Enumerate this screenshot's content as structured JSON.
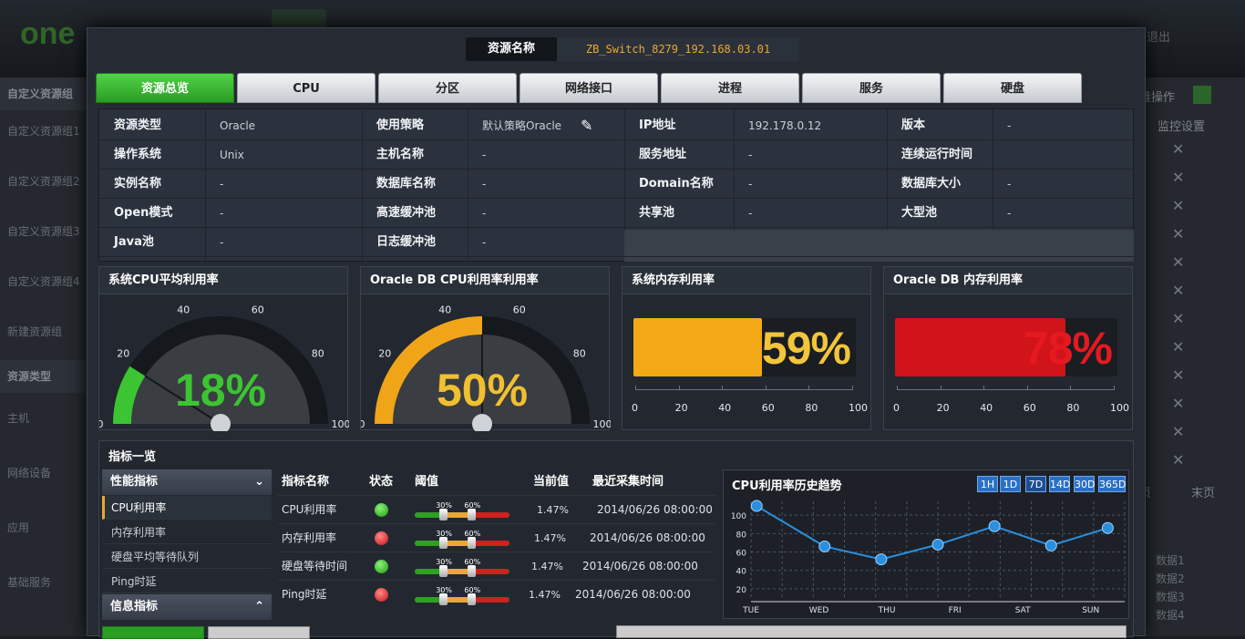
{
  "background": {
    "logo": "one",
    "logout": "退出",
    "left_items": [
      "自定义资源组",
      "自定义资源组1",
      "自定义资源组2",
      "自定义资源组3",
      "自定义资源组4",
      "新建资源组",
      "资源类型",
      "主机",
      "网络设备",
      "应用",
      "基础服务"
    ],
    "right_header_a": "量操作",
    "right_header_b": "监控设置",
    "pager_a": "页",
    "pager_b": "末页",
    "legend": [
      "数据1",
      "数据2",
      "数据3",
      "数据4"
    ]
  },
  "header": {
    "name_label": "资源名称",
    "name_value": "ZB_Switch_8279_192.168.03.01"
  },
  "tabs": [
    "资源总览",
    "CPU",
    "分区",
    "网络接口",
    "进程",
    "服务",
    "硬盘"
  ],
  "info": {
    "rows": [
      [
        [
          "资源类型",
          "Oracle"
        ],
        [
          "使用策略",
          "默认策略Oracle"
        ],
        [
          "IP地址",
          "192.178.0.12"
        ],
        [
          "版本",
          "-"
        ]
      ],
      [
        [
          "操作系统",
          "Unix"
        ],
        [
          "主机名称",
          "-"
        ],
        [
          "服务地址",
          "-"
        ],
        [
          "连续运行时间",
          ""
        ]
      ],
      [
        [
          "实例名称",
          "-"
        ],
        [
          "数据库名称",
          "-"
        ],
        [
          "Domain名称",
          "-"
        ],
        [
          "数据库大小",
          "-"
        ]
      ],
      [
        [
          "Open模式",
          "-"
        ],
        [
          "高速缓冲池",
          "-"
        ],
        [
          "共享池",
          "-"
        ],
        [
          "大型池",
          "-"
        ]
      ],
      [
        [
          "Java池",
          "-"
        ],
        [
          "日志缓冲池",
          "-"
        ]
      ]
    ]
  },
  "gauges": [
    {
      "title": "系统CPU平均利用率",
      "value": 18,
      "label": "18%",
      "color": "#3cc432",
      "text_color": "#3cc432"
    },
    {
      "title": "Oracle DB CPU利用率利用率",
      "value": 50,
      "label": "50%",
      "color": "#f0a418",
      "text_color": "#f0c030"
    }
  ],
  "gauge_ticks": [
    "0",
    "20",
    "40",
    "60",
    "80",
    "100"
  ],
  "bars": [
    {
      "title": "系统内存利用率",
      "value": 59,
      "label": "59%",
      "color": "#f2a915",
      "text_color": "#f2c53a"
    },
    {
      "title": "Oracle DB 内存利用率",
      "value": 78,
      "label": "78%",
      "color": "#d0141a",
      "text_color": "#e5191f"
    }
  ],
  "bar_ticks": [
    "0",
    "20",
    "40",
    "60",
    "80",
    "100"
  ],
  "metrics": {
    "title": "指标一览",
    "perf_head": "性能指标",
    "perf_items": [
      "CPU利用率",
      "内存利用率",
      "硬盘平均等待队列",
      "Ping时延"
    ],
    "info_head": "信息指标",
    "columns": [
      "指标名称",
      "状态",
      "阈值",
      "当前值",
      "最近采集时间"
    ],
    "rows": [
      {
        "name": "CPU利用率",
        "status": "green",
        "low": "30%",
        "high": "60%",
        "value": "1.47%",
        "time": "2014/06/26 08:00:00"
      },
      {
        "name": "内存利用率",
        "status": "red",
        "low": "30%",
        "high": "60%",
        "value": "1.47%",
        "time": "2014/06/26 08:00:00"
      },
      {
        "name": "硬盘等待时间",
        "status": "green",
        "low": "30%",
        "high": "60%",
        "value": "1.47%",
        "time": "2014/06/26 08:00:00"
      },
      {
        "name": "Ping时延",
        "status": "red",
        "low": "30%",
        "high": "60%",
        "value": "1.47%",
        "time": "2014/06/26 08:00:00"
      }
    ]
  },
  "chart_data": {
    "type": "line",
    "title": "CPU利用率历史趋势",
    "ranges": [
      "1H",
      "1D",
      "7D",
      "14D",
      "30D",
      "365D"
    ],
    "active_range": "7D",
    "categories": [
      "TUE",
      "WED",
      "THU",
      "FRI",
      "SAT",
      "SUN"
    ],
    "x": [
      0,
      1,
      2,
      3,
      4,
      5,
      6,
      7
    ],
    "values": [
      110,
      66,
      52,
      68,
      88,
      67,
      86
    ],
    "x_points": [
      0.1,
      1.3,
      2.3,
      3.3,
      4.3,
      5.3,
      6.3
    ],
    "yticks": [
      20,
      40,
      60,
      80,
      100
    ],
    "ylim": [
      10,
      115
    ],
    "line_color": "#2b8fe0",
    "grid": true
  }
}
